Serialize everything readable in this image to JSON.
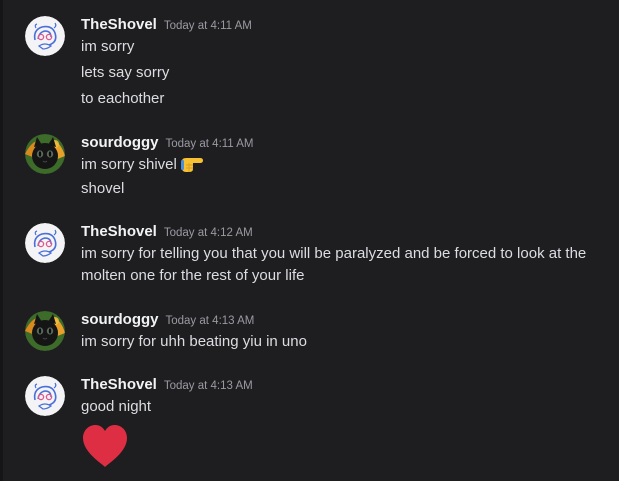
{
  "messages": [
    {
      "username": "TheShovel",
      "timestamp": "Today at 4:11 AM",
      "avatar_icon": "shovel-swirl-avatar-icon",
      "lines": [
        "im sorry",
        "lets say sorry",
        "to eachother"
      ]
    },
    {
      "username": "sourdoggy",
      "timestamp": "Today at 4:11 AM",
      "avatar_icon": "black-cat-avatar-icon",
      "lines": [
        "im sorry shivel",
        "shovel"
      ],
      "inline_emoji": "pointing-hand-emoji"
    },
    {
      "username": "TheShovel",
      "timestamp": "Today at 4:12 AM",
      "avatar_icon": "shovel-swirl-avatar-icon",
      "lines": [
        "im sorry for telling you that you will be paralyzed and be forced to look at the molten one for the rest of your life"
      ]
    },
    {
      "username": "sourdoggy",
      "timestamp": "Today at 4:13 AM",
      "avatar_icon": "black-cat-avatar-icon",
      "lines": [
        "im sorry for uhh beating yiu in uno"
      ]
    },
    {
      "username": "TheShovel",
      "timestamp": "Today at 4:13 AM",
      "avatar_icon": "shovel-swirl-avatar-icon",
      "lines": [
        "good night"
      ],
      "big_emoji": "red-heart-emoji"
    }
  ],
  "colors": {
    "background": "#1e1e21",
    "username": "#f2f3f5",
    "text": "#dcdde1",
    "timestamp": "#9a9ba1",
    "heart": "#dd2e44"
  }
}
